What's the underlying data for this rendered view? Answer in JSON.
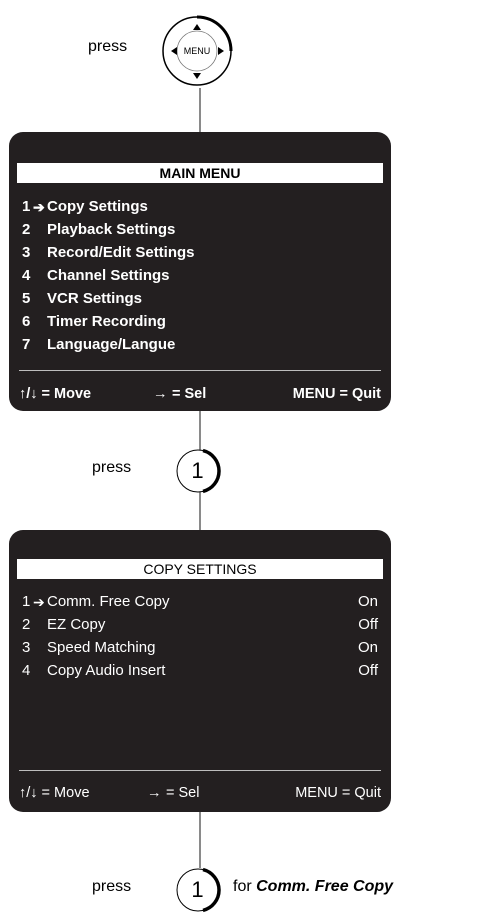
{
  "step1": {
    "press_label": "press",
    "button_label": "MENU"
  },
  "main_menu": {
    "title": "MAIN MENU",
    "items": [
      {
        "num": "1",
        "label": "Copy Settings",
        "selected": true
      },
      {
        "num": "2",
        "label": "Playback Settings"
      },
      {
        "num": "3",
        "label": "Record/Edit Settings"
      },
      {
        "num": "4",
        "label": "Channel Settings"
      },
      {
        "num": "5",
        "label": "VCR Settings"
      },
      {
        "num": "6",
        "label": "Timer Recording"
      },
      {
        "num": "7",
        "label": "Language/Langue"
      }
    ],
    "footer": {
      "move": "↑/↓ = Move",
      "sel_arrow": "→",
      "sel": "= Sel",
      "quit": "MENU = Quit"
    }
  },
  "step2": {
    "press_label": "press",
    "button_number": "1"
  },
  "copy_settings": {
    "title": "COPY SETTINGS",
    "items": [
      {
        "num": "1",
        "label": "Comm. Free Copy",
        "value": "On",
        "selected": true
      },
      {
        "num": "2",
        "label": "EZ Copy",
        "value": "Off"
      },
      {
        "num": "3",
        "label": "Speed Matching",
        "value": "On"
      },
      {
        "num": "4",
        "label": "Copy Audio Insert",
        "value": "Off"
      }
    ],
    "footer": {
      "move": "↑/↓  = Move",
      "sel_arrow": "→",
      "sel": "= Sel",
      "quit": "MENU = Quit"
    }
  },
  "step3": {
    "press_label": "press",
    "button_number": "1",
    "for_label": "for",
    "target": "Comm. Free Copy"
  },
  "colors": {
    "screen_bg": "#231f20",
    "connector": "#8a8a8a"
  }
}
